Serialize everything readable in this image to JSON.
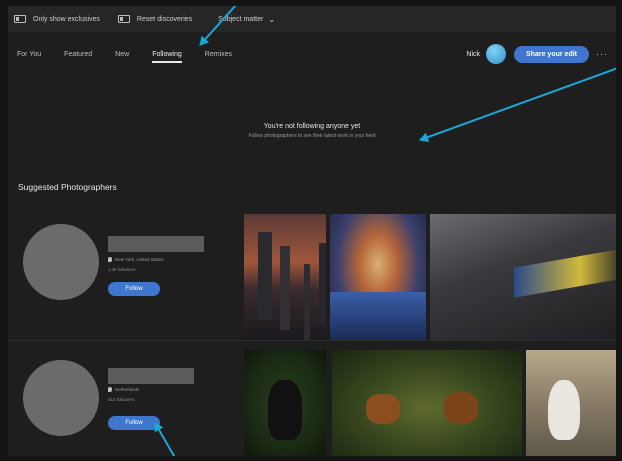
{
  "filter_bar": {
    "filters": [
      {
        "label": "Only show exclusives"
      },
      {
        "label": "Reset discoveries"
      }
    ],
    "dropdown_label": "Subject matter"
  },
  "nav": {
    "tabs": [
      {
        "label": "For You",
        "active": false
      },
      {
        "label": "Featured",
        "active": false
      },
      {
        "label": "New",
        "active": false
      },
      {
        "label": "Following",
        "active": true
      },
      {
        "label": "Remixes",
        "active": false
      }
    ],
    "username": "Nick",
    "share_label": "Share your edit",
    "more_label": "···"
  },
  "empty_state": {
    "title": "You're not following anyone yet",
    "subtitle": "Follow photographers to see their latest work in your feed"
  },
  "suggested": {
    "title": "Suggested Photographers",
    "photographers": [
      {
        "location": "New York, United States",
        "followers": "1.4k followers",
        "follow_label": "Follow"
      },
      {
        "location": "Netherlands",
        "followers": "812 followers",
        "follow_label": "Follow"
      }
    ]
  },
  "colors": {
    "accent": "#3f77cf",
    "annotation_arrow": "#19a7d8",
    "background": "#1e1e1e"
  }
}
